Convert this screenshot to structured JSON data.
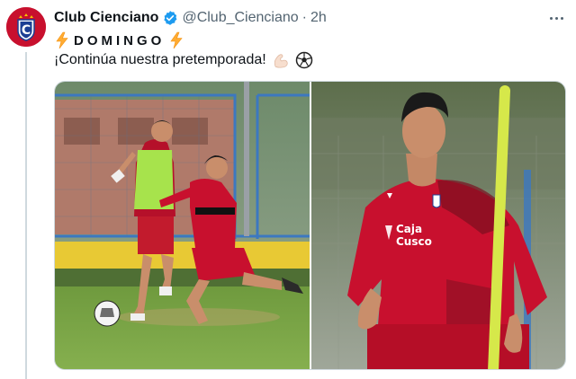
{
  "tweet": {
    "display_name": "Club Cienciano",
    "handle": "@Club_Cienciano",
    "separator": "·",
    "time": "2h",
    "line1": {
      "day": "DOMINGO"
    },
    "line2": {
      "text": "¡Continúa nuestra pretemporada!"
    },
    "avatar_letter": "C",
    "icons": [
      "verified-badge",
      "high-voltage",
      "flexed-biceps",
      "soccer-ball",
      "more-options"
    ],
    "media": [
      {
        "description_name": "training-photo-players-dueling"
      },
      {
        "description_name": "training-photo-player-portrait"
      }
    ],
    "jersey_text_top": "Caja",
    "jersey_text_bottom": "Cusco"
  },
  "colors": {
    "brand_red": "#c8102e",
    "verified_blue": "#1d9bf0",
    "muted": "#536471",
    "text": "#0f1419"
  }
}
